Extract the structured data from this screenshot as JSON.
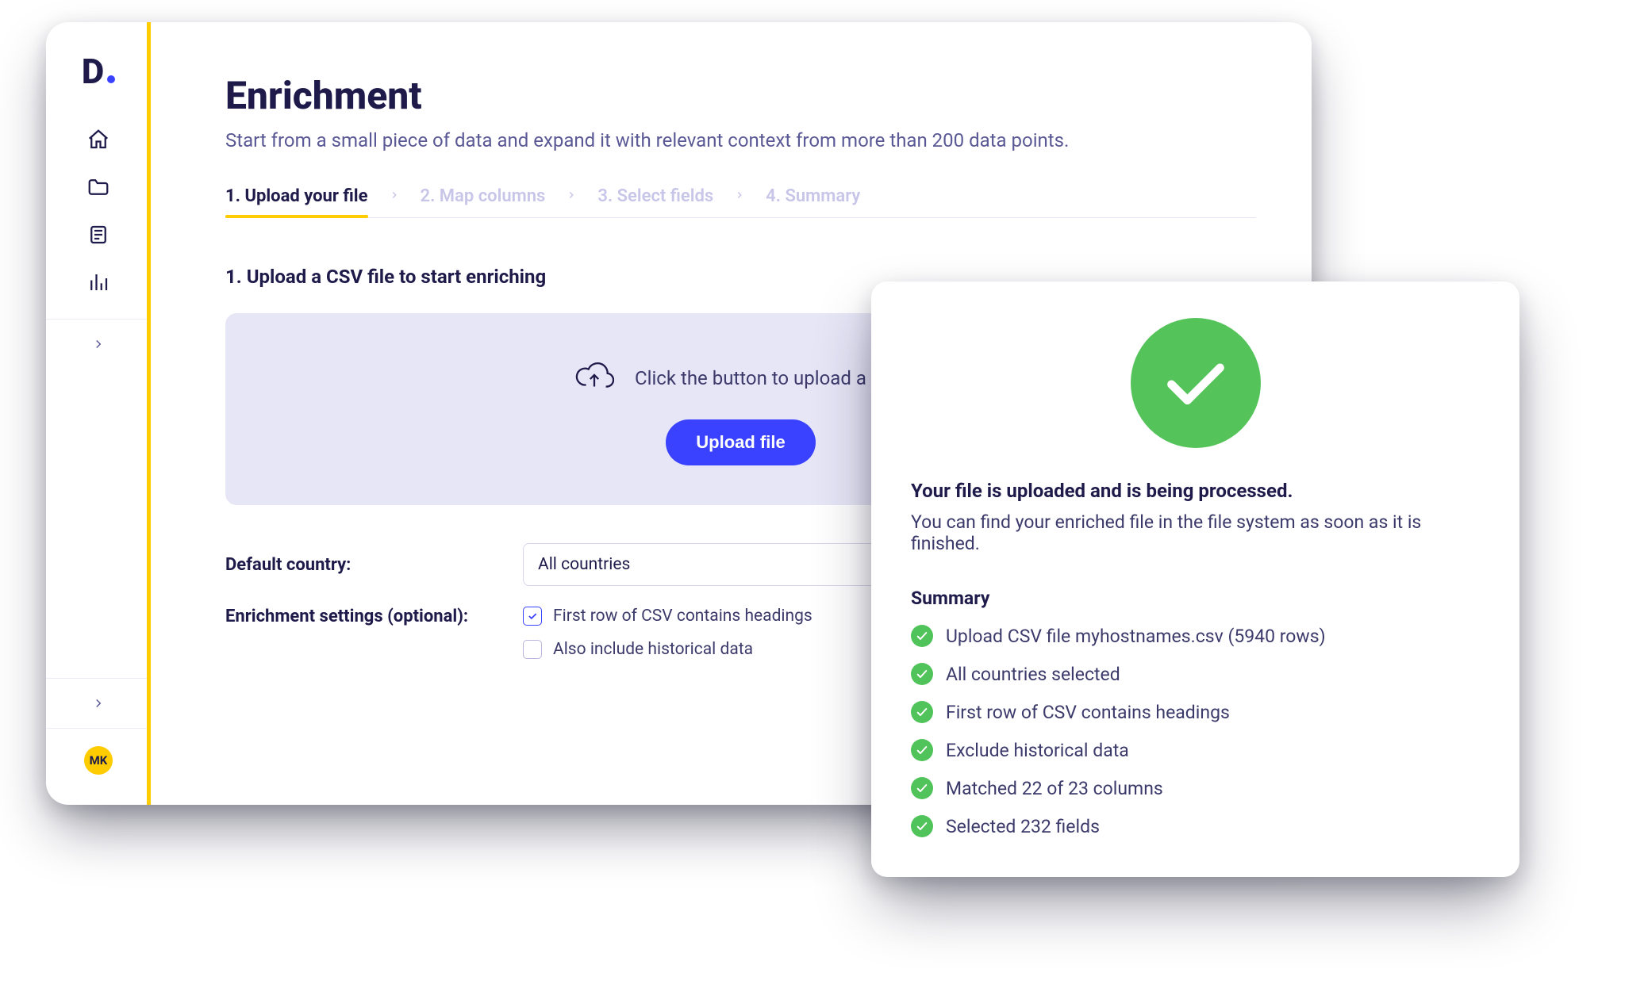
{
  "sidebar": {
    "avatar_initials": "MK"
  },
  "page": {
    "title": "Enrichment",
    "subtitle": "Start from a small piece of data and expand it with relevant context from more than 200 data points."
  },
  "steps": [
    {
      "label": "1. Upload your file",
      "active": true
    },
    {
      "label": "2. Map columns",
      "active": false
    },
    {
      "label": "3. Select fields",
      "active": false
    },
    {
      "label": "4. Summary",
      "active": false
    }
  ],
  "upload": {
    "heading": "1. Upload a CSV file to start enriching",
    "dropzone_text": "Click the button to upload a CSV",
    "button_label": "Upload file"
  },
  "form": {
    "country_label": "Default country:",
    "country_value": "All countries",
    "settings_label": "Enrichment settings (optional):",
    "check_headings": "First row of CSV contains headings",
    "check_historical": "Also include historical data"
  },
  "modal": {
    "title": "Your file is uploaded and is being processed.",
    "subtitle": "You can find your enriched file in the file system as soon as it is finished.",
    "summary_heading": "Summary",
    "items": [
      "Upload CSV file myhostnames.csv (5940 rows)",
      "All countries selected",
      "First row of CSV contains headings",
      "Exclude historical data",
      "Matched 22 of 23 columns",
      "Selected 232 fields"
    ]
  }
}
